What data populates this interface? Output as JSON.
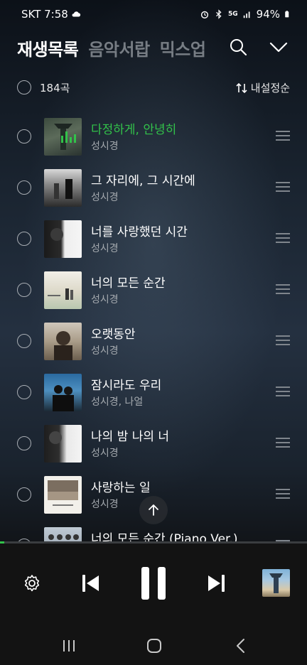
{
  "status_bar": {
    "carrier_time": "SKT 7:58",
    "network": "5G",
    "battery": "94%"
  },
  "header": {
    "tabs": [
      {
        "label": "재생목록",
        "active": true
      },
      {
        "label": "음악서랍",
        "active": false
      },
      {
        "label": "믹스업",
        "active": false
      }
    ],
    "search_icon": "search-icon",
    "collapse_icon": "chevron-down-icon"
  },
  "list_header": {
    "count": "184곡",
    "sort_label": "내설정순"
  },
  "tracks": [
    {
      "title": "다정하게, 안녕히",
      "artist": "성시경",
      "playing": true
    },
    {
      "title": "그 자리에, 그 시간에",
      "artist": "성시경",
      "playing": false
    },
    {
      "title": "너를 사랑했던 시간",
      "artist": "성시경",
      "playing": false
    },
    {
      "title": "너의 모든 순간",
      "artist": "성시경",
      "playing": false
    },
    {
      "title": "오랫동안",
      "artist": "성시경",
      "playing": false
    },
    {
      "title": "잠시라도 우리",
      "artist": "성시경, 나얼",
      "playing": false
    },
    {
      "title": "나의 밤 나의 너",
      "artist": "성시경",
      "playing": false
    },
    {
      "title": "사랑하는 일",
      "artist": "성시경",
      "playing": false
    },
    {
      "title": "너의 모든 순간 (Piano Ver.)",
      "artist": "",
      "playing": false
    }
  ],
  "player": {
    "progress": 0.015,
    "accent_color": "#32c24a"
  }
}
